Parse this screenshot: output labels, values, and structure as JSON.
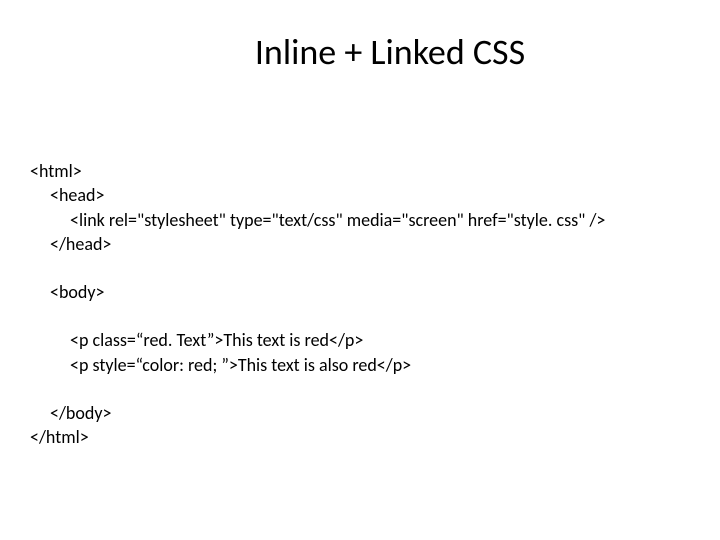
{
  "title": "Inline + Linked CSS",
  "code": {
    "line1": "<html>",
    "line2": "<head>",
    "line3": "<link rel=\"stylesheet\" type=\"text/css\" media=\"screen\" href=\"style. css\" />",
    "line4": "</head>",
    "line5": "<body>",
    "line6": "<p class=“red. Text”>This text is red</p>",
    "line7": "<p style=“color: red; ”>This text is also red</p>",
    "line8": "</body>",
    "line9": "</html>"
  }
}
